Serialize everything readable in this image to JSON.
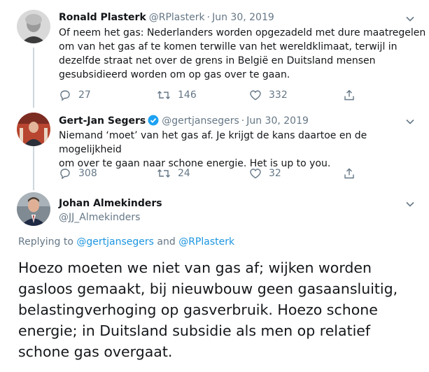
{
  "tweets": [
    {
      "name": "Ronald Plasterk",
      "handle": "@RPlasterk",
      "separator": "·",
      "date": "Jun 30, 2019",
      "lines": [
        "Of neem het gas: Nederlanders worden opgezadeld met dure maatregelen",
        "om van het gas af te komen terwille van het wereldklimaat, terwijl in",
        "dezelfde straat net over de grens in België en Duitsland mensen",
        "gesubsidieerd worden om op gas over te gaan."
      ],
      "replies": "27",
      "retweets": "146",
      "likes": "332"
    },
    {
      "name": "Gert-Jan Segers",
      "handle": "@gertjansegers",
      "separator": "·",
      "date": "Jun 30, 2019",
      "verified": true,
      "lines": [
        "Niemand ‘moet’ van het gas af. Je krijgt de kans daartoe en de mogelijkheid",
        "om over te gaan naar schone energie. Het is up to you."
      ],
      "replies": "308",
      "retweets": "24",
      "likes": "32"
    }
  ],
  "main_tweet": {
    "name": "Johan Almekinders",
    "handle": "@JJ_Almekinders",
    "reply_prefix": "Replying to",
    "mention_1": "@gertjansegers",
    "reply_and": "and",
    "mention_2": "@RPlasterk",
    "lines": [
      "Hoezo moeten we niet van gas af; wijken worden",
      "gasloos gemaakt, bij nieuwbouw geen gasaansluitig,",
      "belastingverhoging op gasverbruik. Hoezo schone",
      "energie; in Duitsland subsidie als men op relatief",
      "schone gas overgaat."
    ]
  },
  "colors": {
    "text": "#14171a",
    "muted": "#657786",
    "link": "#1b95e0",
    "verified": "#1da1f2",
    "thread_line": "#ccd6dd"
  },
  "icons": [
    "chevron-down-icon",
    "reply-icon",
    "retweet-icon",
    "like-icon",
    "share-icon",
    "verified-badge-icon"
  ]
}
